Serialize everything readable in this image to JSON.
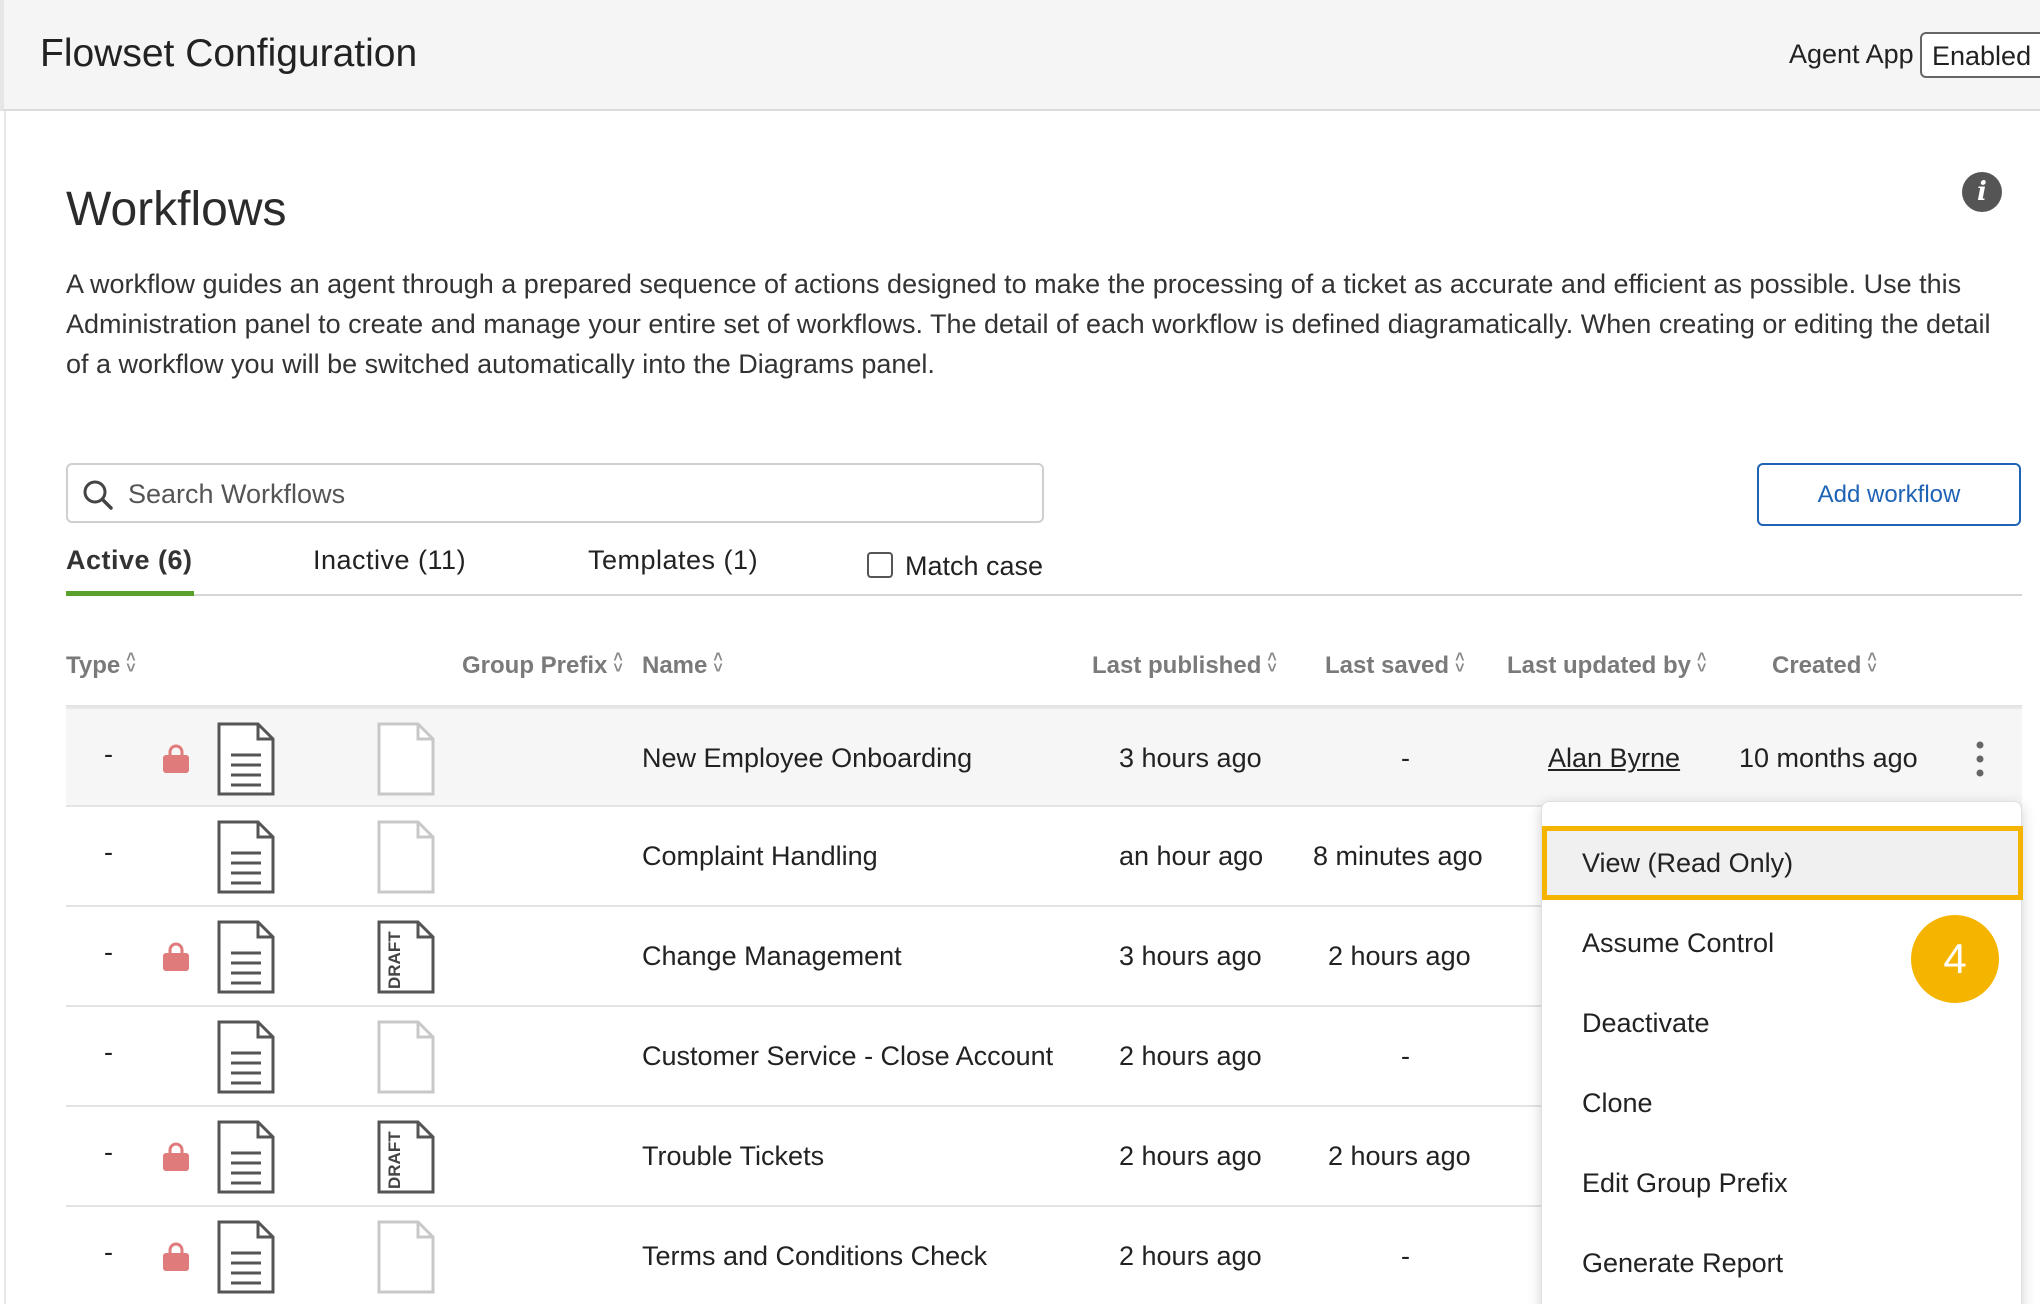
{
  "header": {
    "title": "Flowset Configuration",
    "agent_app_label": "Agent App",
    "agent_app_value": "Enabled"
  },
  "page": {
    "title": "Workflows",
    "description": "A workflow guides an agent through a prepared sequence of actions designed to make the processing of a ticket as accurate and efficient as possible. Use this Administration panel to create and manage your entire set of workflows. The detail of each workflow is defined diagramatically. When creating or editing the detail of a workflow you will be switched automatically into the Diagrams panel."
  },
  "search": {
    "placeholder": "Search Workflows"
  },
  "add_button": "Add workflow",
  "tabs": [
    {
      "label": "Active (6)",
      "active": true
    },
    {
      "label": "Inactive (11)",
      "active": false
    },
    {
      "label": "Templates (1)",
      "active": false
    }
  ],
  "match_case": {
    "label": "Match case",
    "checked": false
  },
  "columns": {
    "type": "Type",
    "group_prefix": "Group Prefix",
    "name": "Name",
    "last_published": "Last published",
    "last_saved": "Last saved",
    "last_updated_by": "Last updated by",
    "created": "Created"
  },
  "rows": [
    {
      "type": "-",
      "locked": true,
      "draft": false,
      "name": "New Employee Onboarding",
      "last_published": "3 hours ago",
      "last_saved": "-",
      "last_updated_by": "Alan Byrne",
      "created": "10 months ago"
    },
    {
      "type": "-",
      "locked": false,
      "draft": false,
      "name": "Complaint Handling",
      "last_published": "an hour ago",
      "last_saved": "8 minutes ago"
    },
    {
      "type": "-",
      "locked": true,
      "draft": true,
      "name": "Change Management",
      "last_published": "3 hours ago",
      "last_saved": "2 hours ago"
    },
    {
      "type": "-",
      "locked": false,
      "draft": false,
      "name": "Customer Service - Close Account",
      "last_published": "2 hours ago",
      "last_saved": "-"
    },
    {
      "type": "-",
      "locked": true,
      "draft": true,
      "name": "Trouble Tickets",
      "last_published": "2 hours ago",
      "last_saved": "2 hours ago"
    },
    {
      "type": "-",
      "locked": true,
      "draft": false,
      "name": "Terms and Conditions Check",
      "last_published": "2 hours ago",
      "last_saved": "-"
    }
  ],
  "draft_label": "DRAFT",
  "context_menu": {
    "items": [
      "View (Read Only)",
      "Assume Control",
      "Deactivate",
      "Clone",
      "Edit Group Prefix",
      "Generate Report"
    ],
    "highlighted_index": 0
  },
  "step_badge": "4",
  "colors": {
    "accent_blue": "#1f63b5",
    "active_tab_green": "#5aa02c",
    "highlight_yellow": "#f5b400",
    "lock_red": "#e07b7b"
  }
}
